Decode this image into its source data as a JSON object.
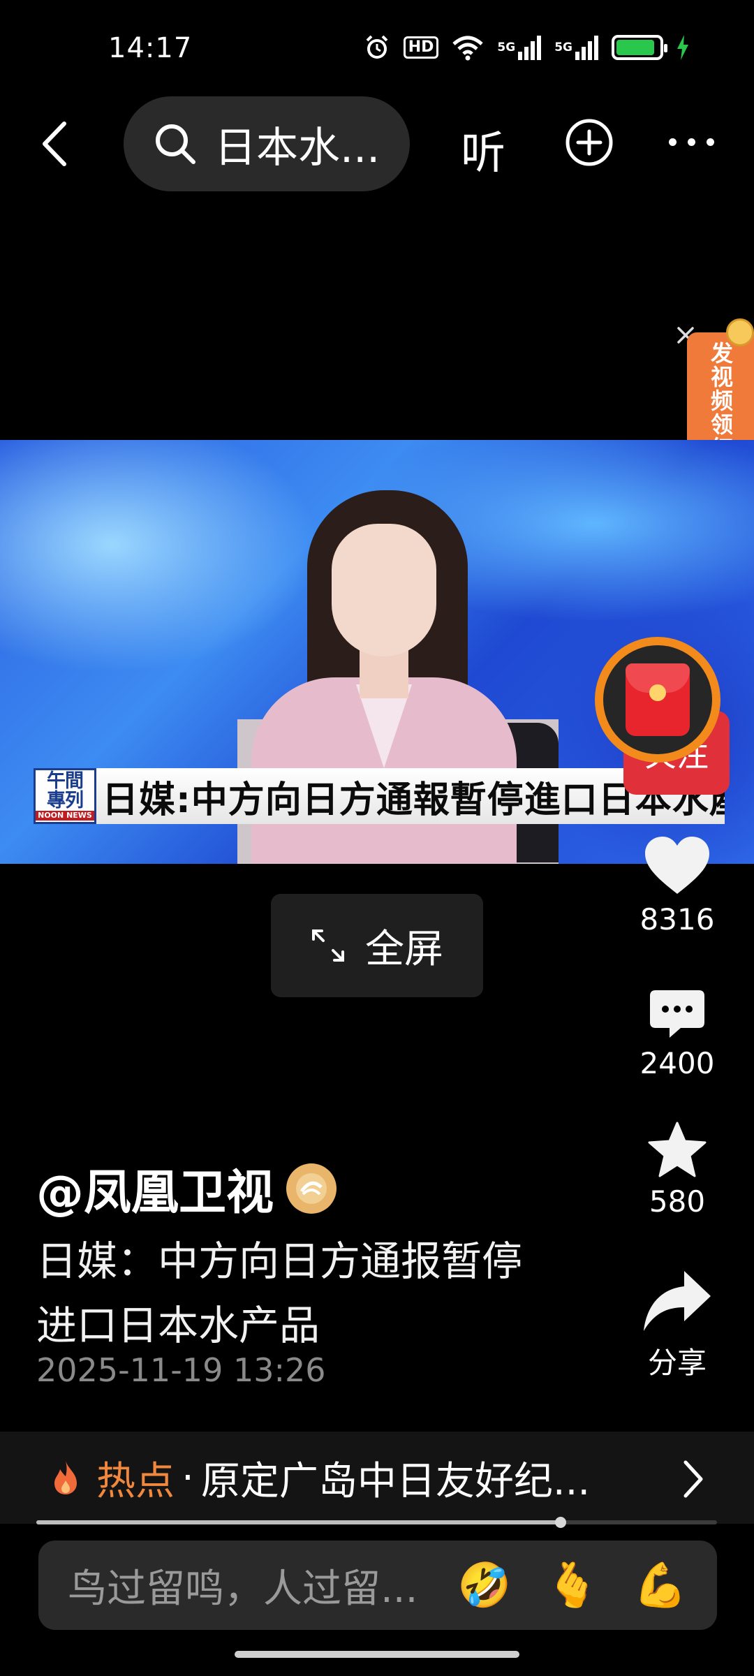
{
  "status_bar": {
    "time": "14:17",
    "network_1": "5G",
    "network_2": "5G",
    "hd": "HD",
    "battery_level": 0.9,
    "battery_color": "#29c74b"
  },
  "top_nav": {
    "search_text": "日本水...",
    "listen_label": "听"
  },
  "video": {
    "logo_line1": "午間",
    "logo_line2": "專列",
    "logo_foot": "NOON NEWS",
    "caption": "日媒:中方向日方通報暫停進口日本水產品"
  },
  "fullscreen_label": "全屏",
  "promo": {
    "text": "发视频领红包"
  },
  "follow_label": "关注",
  "stats": {
    "likes": "8316",
    "comments": "2400",
    "favorites": "580",
    "share_label": "分享"
  },
  "info": {
    "author": "@凤凰卫视",
    "description": "日媒：中方向日方通报暂停进口日本水产品",
    "timestamp": "2025-11-19 13:26"
  },
  "hot": {
    "label": "热点",
    "separator": "·",
    "text": "原定广岛中日友好纪..."
  },
  "progress": 0.77,
  "comment_bar": {
    "placeholder": "鸟过留鸣，人过留...",
    "emoji_1": "🤣",
    "emoji_2": "🫰",
    "emoji_3": "💪"
  },
  "colors": {
    "accent_orange": "#f0883e",
    "follow_red": "#e0303a",
    "promo_orange": "#f07a3a"
  }
}
